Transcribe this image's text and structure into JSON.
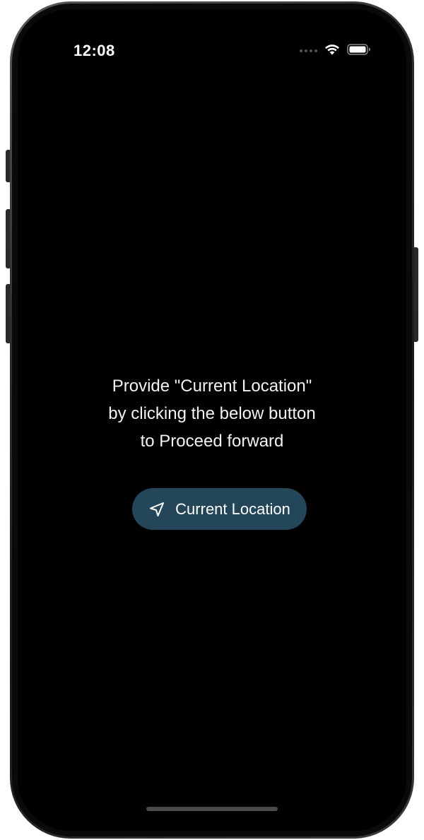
{
  "status_bar": {
    "time": "12:08",
    "icons": [
      "signal-dots-icon",
      "wifi-icon",
      "battery-icon"
    ]
  },
  "main": {
    "prompt_lines": [
      "Provide \"Current Location\"",
      "by clicking the below button",
      "to Proceed forward"
    ],
    "location_button": {
      "label": "Current Location",
      "icon": "navigation-arrow-icon"
    }
  },
  "colors": {
    "screen_background": "#000000",
    "button_background": "#234658",
    "text": "#ffffff"
  }
}
